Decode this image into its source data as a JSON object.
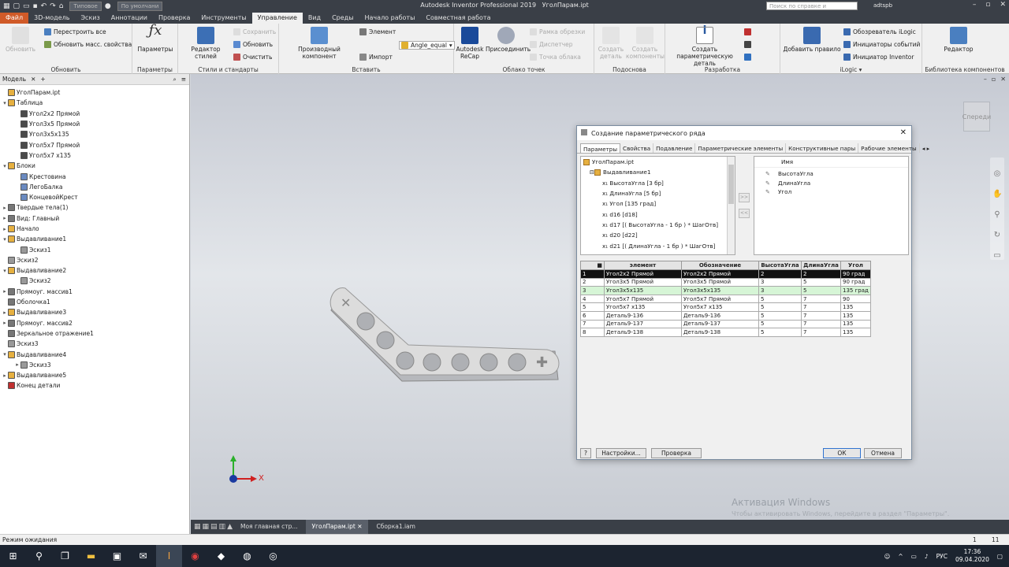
{
  "window": {
    "app_title": "Autodesk Inventor Professional 2019",
    "doc_title": "УголПарам.ipt",
    "search_placeholder": "Поиск по справке и командам...",
    "user": "adtspb",
    "qa_style": "Типовое",
    "qa_default": "По умолчани"
  },
  "ribbon_tabs": [
    "Файл",
    "3D-модель",
    "Эскиз",
    "Аннотации",
    "Проверка",
    "Инструменты",
    "Управление",
    "Вид",
    "Среды",
    "Начало работы",
    "Совместная работа"
  ],
  "ribbon": {
    "update": {
      "label": "Обновить",
      "btn": "Обновить",
      "rebuild": "Перестроить все",
      "mass": "Обновить масс. свойства"
    },
    "params": {
      "label": "Параметры",
      "btn": "Параметры"
    },
    "styles": {
      "label": "Стили и стандарты",
      "editor": "Редактор стилей",
      "save": "Сохранить",
      "update": "Обновить",
      "purge": "Очистить"
    },
    "insert": {
      "label": "Вставить",
      "derived": "Производный компонент",
      "element": "Элемент",
      "angle": "Angle_equal",
      "import": "Импорт"
    },
    "cloud": {
      "label": "Облако точек",
      "recap": "Autodesk ReCap",
      "attach": "Присоединить",
      "crop": "Рамка обрезки",
      "manager": "Диспетчер",
      "point": "Точка облака"
    },
    "substitute": {
      "label": "Подоснова",
      "part": "Создать деталь",
      "comp": "Создать компоненты"
    },
    "dev": {
      "label": "Разработка",
      "create": "Создать параметрическую деталь"
    },
    "ilogic": {
      "label": "iLogic",
      "add": "Добавить правило",
      "browser": "Обозреватель iLogic",
      "events": "Инициаторы событий",
      "trigger": "Инициатор Inventor"
    },
    "library": {
      "label": "Библиотека компонентов",
      "editor": "Редактор"
    }
  },
  "left_panel": {
    "title": "Модель",
    "tree": [
      {
        "label": "УголПарам.ipt",
        "indent": 0,
        "exp": ""
      },
      {
        "label": "Таблица",
        "indent": 0,
        "exp": "▾"
      },
      {
        "label": "Угол2х2 Прямой",
        "indent": 2,
        "exp": ""
      },
      {
        "label": "Угол3х5 Прямой",
        "indent": 2,
        "exp": ""
      },
      {
        "label": "Угол3х5х135",
        "indent": 2,
        "exp": "",
        "check": true
      },
      {
        "label": "Угол5х7 Прямой",
        "indent": 2,
        "exp": ""
      },
      {
        "label": "Угол5х7 х135",
        "indent": 2,
        "exp": ""
      },
      {
        "label": "Блоки",
        "indent": 0,
        "exp": "▾"
      },
      {
        "label": "Крестовина",
        "indent": 2,
        "exp": ""
      },
      {
        "label": "ЛегоБалка",
        "indent": 2,
        "exp": ""
      },
      {
        "label": "КонцевойКрест",
        "indent": 2,
        "exp": ""
      },
      {
        "label": "Твердые тела(1)",
        "indent": 0,
        "exp": "▸"
      },
      {
        "label": "Вид: Главный",
        "indent": 0,
        "exp": "▸"
      },
      {
        "label": "Начало",
        "indent": 0,
        "exp": "▸"
      },
      {
        "label": "Выдавливание1",
        "indent": 0,
        "exp": "▾"
      },
      {
        "label": "Эскиз1",
        "indent": 2,
        "exp": ""
      },
      {
        "label": "Эскиз2",
        "indent": 0,
        "exp": ""
      },
      {
        "label": "Выдавливание2",
        "indent": 0,
        "exp": "▾"
      },
      {
        "label": "Эскиз2",
        "indent": 2,
        "exp": ""
      },
      {
        "label": "Прямоуг. массив1",
        "indent": 0,
        "exp": "▸"
      },
      {
        "label": "Оболочка1",
        "indent": 0,
        "exp": ""
      },
      {
        "label": "Выдавливание3",
        "indent": 0,
        "exp": "▸"
      },
      {
        "label": "Прямоуг. массив2",
        "indent": 0,
        "exp": "▸"
      },
      {
        "label": "Зеркальное отражение1",
        "indent": 0,
        "exp": ""
      },
      {
        "label": "Эскиз3",
        "indent": 0,
        "exp": ""
      },
      {
        "label": "Выдавливание4",
        "indent": 0,
        "exp": "▾"
      },
      {
        "label": "Эскиз3",
        "indent": 2,
        "exp": "▸"
      },
      {
        "label": "Выдавливание5",
        "indent": 0,
        "exp": "▸"
      },
      {
        "label": "Конец детали",
        "indent": 0,
        "exp": ""
      }
    ]
  },
  "viewcube_label": "Спереди",
  "dialog": {
    "title": "Создание параметрического ряда",
    "tabs": [
      "Параметры",
      "Свойства",
      "Подавление",
      "Параметрические элементы",
      "Конструктивные пары",
      "Рабочие элементы"
    ],
    "left_tree": [
      {
        "label": "УголПарам.ipt",
        "indent": 0
      },
      {
        "label": "Выдавливание1",
        "indent": 1,
        "exp": "⊟"
      },
      {
        "label": "x₁ ВысотаУгла [3 бр]",
        "indent": 3
      },
      {
        "label": "x₁ ДлинаУгла [5 бр]",
        "indent": 3
      },
      {
        "label": "x₁ Угол [135 град]",
        "indent": 3
      },
      {
        "label": "x₁ d16 [d18]",
        "indent": 3
      },
      {
        "label": "x₁ d17 [( ВысотаУгла - 1 бр ) * ШагОтв]",
        "indent": 3
      },
      {
        "label": "x₁ d20 [d22]",
        "indent": 3
      },
      {
        "label": "x₁ d21 [( ДлинаУгла - 1 бр ) * ШагОтв]",
        "indent": 3
      }
    ],
    "right_header": "Имя",
    "right_items": [
      "ВысотаУгла",
      "ДлинаУгла",
      "Угол"
    ],
    "columns": [
      "",
      "элемент",
      "Обозначение",
      "ВысотаУгла",
      "ДлинаУгла",
      "Угол"
    ],
    "rows": [
      [
        "1",
        "Угол2х2 Прямой",
        "Угол2х2 Прямой",
        "2",
        "2",
        "90 град"
      ],
      [
        "2",
        "Угол3х5 Прямой",
        "Угол3х5 Прямой",
        "3",
        "5",
        "90 град"
      ],
      [
        "3",
        "Угол3х5х135",
        "Угол3х5х135",
        "3",
        "5",
        "135 град"
      ],
      [
        "4",
        "Угол5х7 Прямой",
        "Угол5х7 Прямой",
        "5",
        "7",
        "90"
      ],
      [
        "5",
        "Угол5х7 х135",
        "Угол5х7 х135",
        "5",
        "7",
        "135"
      ],
      [
        "6",
        "Деталь9-136",
        "Деталь9-136",
        "5",
        "7",
        "135"
      ],
      [
        "7",
        "Деталь9-137",
        "Деталь9-137",
        "5",
        "7",
        "135"
      ],
      [
        "8",
        "Деталь9-138",
        "Деталь9-138",
        "5",
        "7",
        "135"
      ]
    ],
    "settings_btn": "Настройки...",
    "check_btn": "Проверка",
    "ok_btn": "ОК",
    "cancel_btn": "Отмена"
  },
  "doc_tabs": [
    "Моя главная стр...",
    "УголПарам.ipt",
    "Сборка1.iam"
  ],
  "status": {
    "text": "Режим ожидания",
    "n1": "1",
    "n2": "11"
  },
  "watermark": {
    "title": "Активация Windows",
    "sub": "Чтобы активировать Windows, перейдите в раздел \"Параметры\"."
  },
  "tray": {
    "lang": "РУС",
    "time": "17:36",
    "date": "09.04.2020"
  },
  "axis": {
    "x": "X"
  },
  "colors": {
    "accent": "#d05a28",
    "dark": "#3a3f47"
  }
}
